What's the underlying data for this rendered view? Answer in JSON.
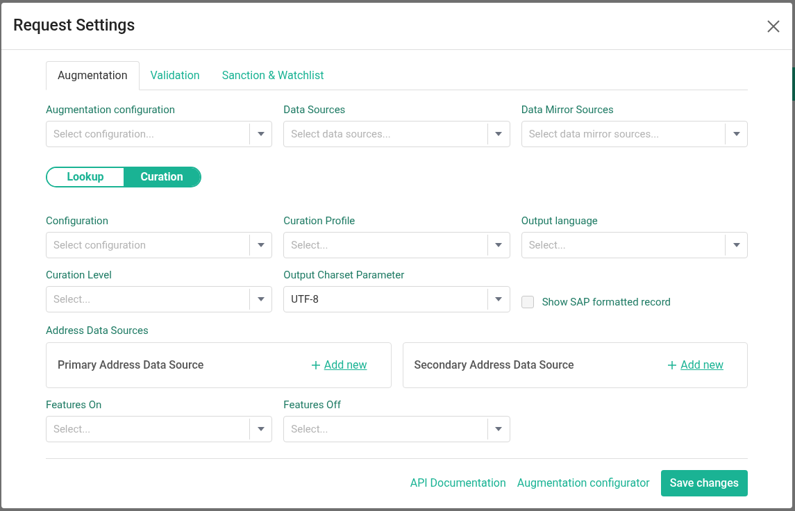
{
  "dialog": {
    "title": "Request Settings"
  },
  "tabs": [
    {
      "label": "Augmentation",
      "selected": true
    },
    {
      "label": "Validation",
      "selected": false
    },
    {
      "label": "Sanction & Watchlist",
      "selected": false
    }
  ],
  "top_fields": [
    {
      "kind": "select",
      "label": "Augmentation configuration",
      "placeholder": "Select configuration..."
    },
    {
      "kind": "select",
      "label": "Data Sources",
      "placeholder": "Select data sources..."
    },
    {
      "kind": "select",
      "label": "Data Mirror Sources",
      "placeholder": "Select data mirror sources..."
    }
  ],
  "mode_toggle": [
    {
      "label": "Lookup",
      "selected": false
    },
    {
      "label": "Curation",
      "selected": true
    }
  ],
  "field_rows": [
    [
      {
        "kind": "select",
        "label": "Configuration",
        "placeholder": "Select configuration"
      },
      {
        "kind": "select",
        "label": "Curation Profile",
        "placeholder": "Select..."
      },
      {
        "kind": "select",
        "label": "Output language",
        "placeholder": "Select..."
      }
    ],
    [
      {
        "kind": "select",
        "label": "Curation Level",
        "placeholder": "Select..."
      },
      {
        "kind": "select",
        "label": "Output Charset Parameter",
        "value": "UTF-8"
      },
      {
        "kind": "checkbox",
        "label": "Show SAP formatted record",
        "checked": false
      }
    ]
  ],
  "address_sources": {
    "label": "Address Data Sources",
    "cards": [
      {
        "title": "Primary Address Data Source",
        "action": "Add new"
      },
      {
        "title": "Secondary Address Data Source",
        "action": "Add new"
      }
    ]
  },
  "feature_fields": [
    {
      "kind": "select",
      "label": "Features On",
      "placeholder": "Select..."
    },
    {
      "kind": "select",
      "label": "Features Off",
      "placeholder": "Select..."
    }
  ],
  "footer": {
    "links": [
      "API Documentation",
      "Augmentation configurator"
    ],
    "primary_button": "Save changes"
  }
}
